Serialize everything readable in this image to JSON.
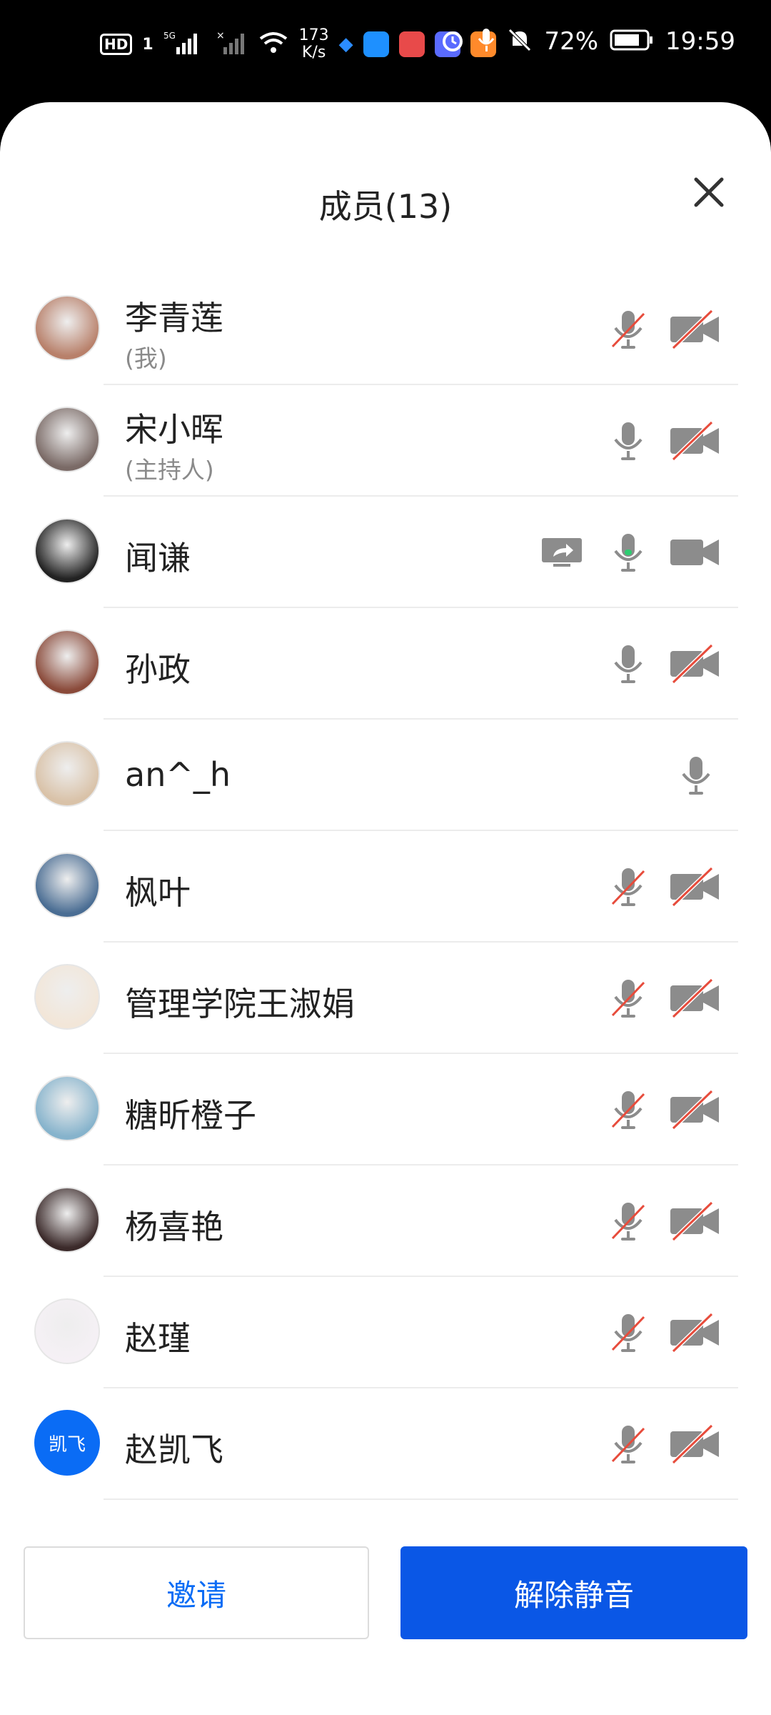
{
  "status_bar": {
    "hd": "HD",
    "sim": "1",
    "net": "5G",
    "speed_top": "173",
    "speed_bottom": "K/s",
    "battery": "72%",
    "time": "19:59"
  },
  "header": {
    "title": "成员(13)"
  },
  "members": [
    {
      "name": "李青莲",
      "sub": "(我)",
      "mic": "muted",
      "cam": "off"
    },
    {
      "name": "宋小晖",
      "sub": "(主持人)",
      "mic": "on",
      "cam": "off"
    },
    {
      "name": "闻谦",
      "sub": "",
      "mic": "speaking",
      "cam": "on",
      "sharing": true
    },
    {
      "name": "孙政",
      "sub": "",
      "mic": "on",
      "cam": "off"
    },
    {
      "name": "an^_h",
      "sub": "",
      "mic": "on",
      "cam": "none"
    },
    {
      "name": "枫叶",
      "sub": "",
      "mic": "muted",
      "cam": "off"
    },
    {
      "name": "管理学院王淑娟",
      "sub": "",
      "mic": "muted",
      "cam": "off"
    },
    {
      "name": "糖昕橙子",
      "sub": "",
      "mic": "muted",
      "cam": "off"
    },
    {
      "name": "杨喜艳",
      "sub": "",
      "mic": "muted",
      "cam": "off"
    },
    {
      "name": "赵瑾",
      "sub": "",
      "mic": "muted",
      "cam": "off"
    },
    {
      "name": "赵凯飞",
      "sub": "",
      "mic": "muted",
      "cam": "off",
      "avatar_text": "凯飞"
    }
  ],
  "buttons": {
    "invite": "邀请",
    "unmute": "解除静音"
  },
  "colors": {
    "primary": "#0a57e6",
    "mute_red": "#e74c3c",
    "icon_gray": "#8c8c8c",
    "speaking": "#2ecc71"
  }
}
